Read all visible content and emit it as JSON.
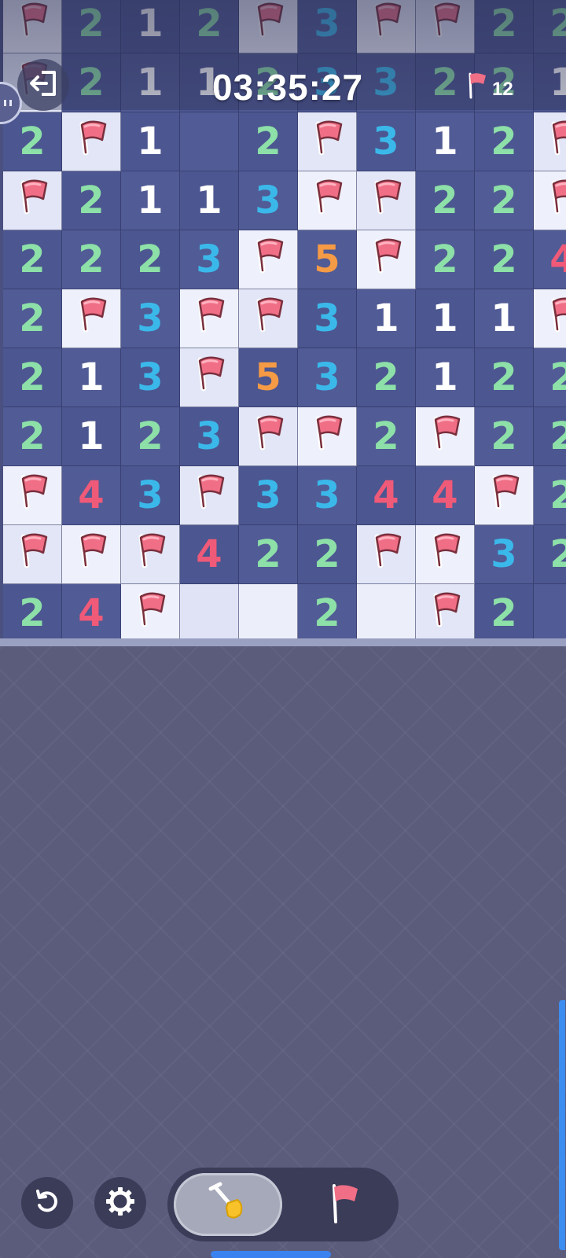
{
  "hud": {
    "timer": "03:35:27",
    "flags_remaining": "12"
  },
  "board": {
    "rows": [
      [
        "F",
        "2",
        "1",
        "2",
        "F",
        "3",
        "F",
        "F",
        "2",
        "2"
      ],
      [
        "F",
        "2",
        "1",
        "1",
        "2",
        "3",
        "3",
        "2",
        "2",
        "1"
      ],
      [
        "2",
        "F",
        "1",
        "",
        "2",
        "F",
        "3",
        "1",
        "2",
        "F"
      ],
      [
        "F",
        "2",
        "1",
        "1",
        "3",
        "F",
        "F",
        "2",
        "2",
        "F"
      ],
      [
        "2",
        "2",
        "2",
        "3",
        "F",
        "5",
        "F",
        "2",
        "2",
        "4"
      ],
      [
        "2",
        "F",
        "3",
        "F",
        "F",
        "3",
        "1",
        "1",
        "1",
        "F"
      ],
      [
        "2",
        "1",
        "3",
        "F",
        "5",
        "3",
        "2",
        "1",
        "2",
        "2"
      ],
      [
        "2",
        "1",
        "2",
        "3",
        "F",
        "F",
        "2",
        "F",
        "2",
        "2"
      ],
      [
        "F",
        "4",
        "3",
        "F",
        "3",
        "3",
        "4",
        "4",
        "F",
        "2"
      ],
      [
        "F",
        "F",
        "F",
        "4",
        "2",
        "2",
        "F",
        "F",
        "3",
        "2"
      ],
      [
        "2",
        "4",
        "F",
        "E",
        "E",
        "2",
        "E",
        "F",
        "2",
        ""
      ]
    ]
  },
  "icons": {
    "exit": "exit-icon",
    "flag_counter": "flag-icon",
    "undo": "undo-icon",
    "settings": "gear-icon",
    "dig_mode": "shovel-icon",
    "flag_mode": "flag-icon"
  },
  "colors": {
    "number_1": "#ffffff",
    "number_2": "#8de0a8",
    "number_3": "#3bb8ea",
    "number_4": "#ef5a78",
    "number_5": "#f59a45",
    "flag": "#f06f86"
  }
}
